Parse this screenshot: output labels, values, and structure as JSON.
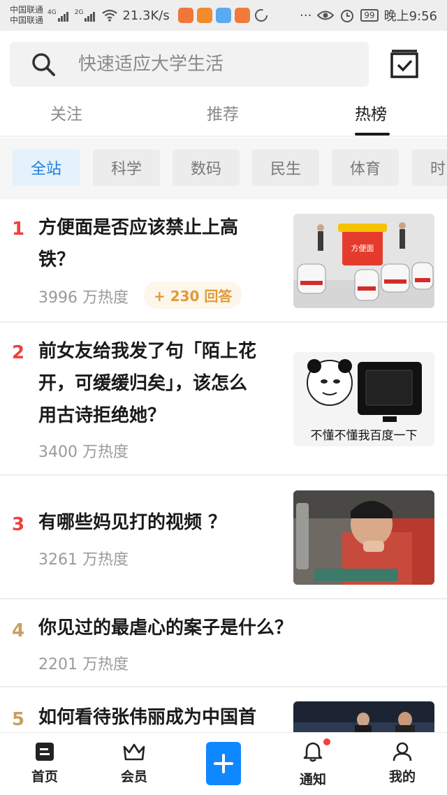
{
  "statusbar": {
    "carrier1": "中国联通",
    "carrier2": "中国联通",
    "net1": "4G",
    "net2": "2G",
    "speed": "21.3K/s",
    "dots": "···",
    "battery": "99",
    "time": "晚上9:56"
  },
  "search": {
    "placeholder": "快速适应大学生活"
  },
  "tabs": [
    "关注",
    "推荐",
    "热榜"
  ],
  "chips": [
    "全站",
    "科学",
    "数码",
    "民生",
    "体育",
    "时"
  ],
  "items": [
    {
      "rank": "1",
      "title_line1": "方便面是否应该禁止上高",
      "title_line2": "铁？",
      "heat": "3996 万热度",
      "answers": "+ 230 回答",
      "thumb_caption": "方便面"
    },
    {
      "rank": "2",
      "title_line1": "前女友给我发了句「陌上花",
      "title_line2": "开，可缓缓归矣」，该怎么",
      "title_line3": "用古诗拒绝她？",
      "heat": "3400 万热度",
      "thumb_caption": "不懂不懂我百度一下"
    },
    {
      "rank": "3",
      "title_line1": "有哪些妈见打的视频 ？",
      "heat": "3261 万热度"
    },
    {
      "rank": "4",
      "title_line1": "你见过的最虐心的案子是什么？",
      "heat": "2201 万热度"
    },
    {
      "rank": "5",
      "title_line1": "如何看待张伟丽成为中国首"
    }
  ],
  "bottomnav": {
    "home": "首页",
    "vip": "会员",
    "notify": "通知",
    "mine": "我的"
  },
  "colors": {
    "accent": "#0f87ff",
    "rank_red": "#f1403c",
    "rank_gold": "#c7a066",
    "answers_orange": "#e09a3a"
  }
}
